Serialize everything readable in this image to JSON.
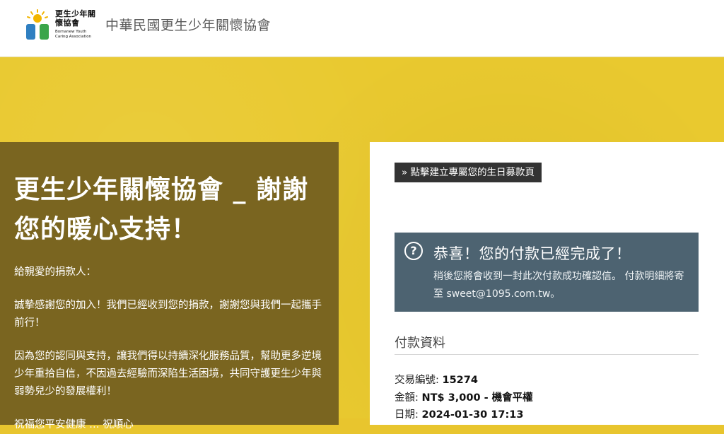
{
  "header": {
    "logo_zh": "更生少年關懷協會",
    "logo_en": "Bornanew Youth Caring Association",
    "site_title": "中華民國更生少年關懷協會"
  },
  "thanks": {
    "title": "更生少年關懷協會 _ 謝謝您的暖心支持！",
    "greeting": "給親愛的捐款人：",
    "para1": "誠摯感謝您的加入！我們已經收到您的捐款，謝謝您與我們一起攜手前行！",
    "para2": "因為您的認同與支持，讓我們得以持續深化服務品質，幫助更多逆境少年重拾自信，不因過去經驗而深陷生活困境，共同守護更生少年與弱勢兒少的發展權利！",
    "para3_partial": "祝福您平安健康 … 祝順心"
  },
  "birthday_button": "» 點擊建立專屬您的生日募款頁",
  "notice": {
    "icon": "question-circle-icon",
    "title": "恭喜！您的付款已經完成了！",
    "body": "稍後您將會收到一封此次付款成功確認信。 付款明細將寄至 sweet@1095.com.tw。"
  },
  "payment": {
    "title": "付款資料",
    "rows": [
      {
        "label": "交易編號:",
        "value": "15274"
      },
      {
        "label": "金額:",
        "value": "NT$ 3,000 - 機會平權"
      },
      {
        "label": "日期:",
        "value": "2024-01-30 17:13"
      }
    ]
  },
  "colors": {
    "background_yellow": "#e9c92f",
    "left_panel": "#7a6520",
    "notice_bg": "#4d6371",
    "button_bg": "#333333"
  }
}
